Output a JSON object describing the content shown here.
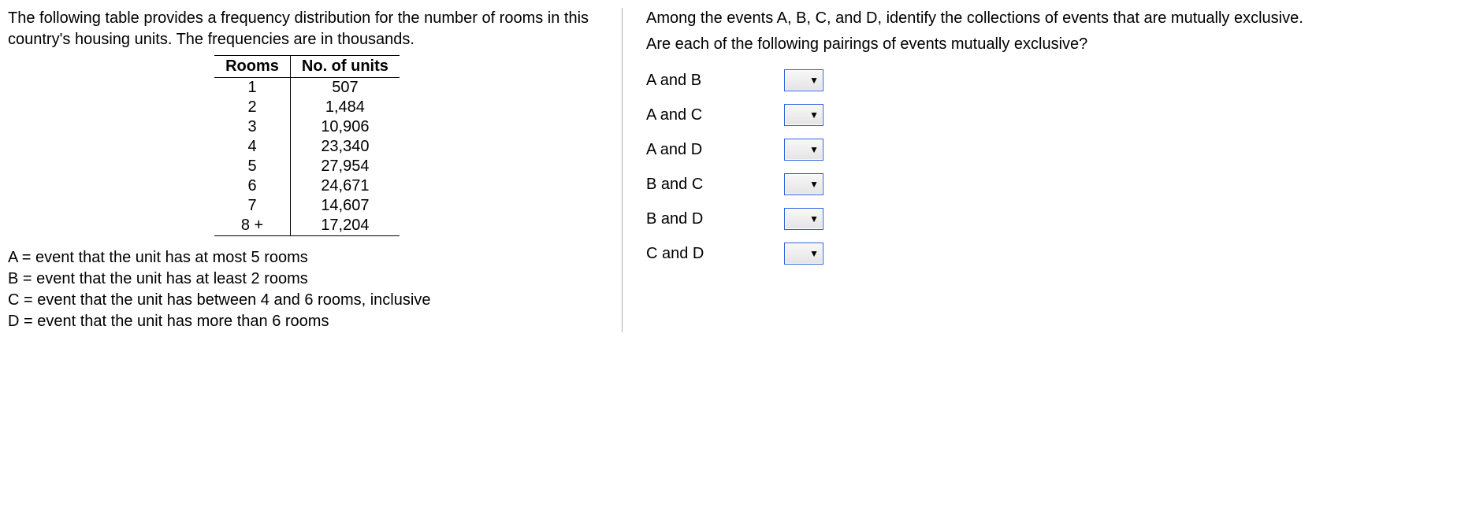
{
  "left": {
    "intro": "The following table provides a frequency distribution for the number of rooms in this country's housing units. The frequencies are in thousands.",
    "table": {
      "headers": {
        "col1": "Rooms",
        "col2": "No. of units"
      },
      "rows": [
        {
          "rooms": "1",
          "units": "507"
        },
        {
          "rooms": "2",
          "units": "1,484"
        },
        {
          "rooms": "3",
          "units": "10,906"
        },
        {
          "rooms": "4",
          "units": "23,340"
        },
        {
          "rooms": "5",
          "units": "27,954"
        },
        {
          "rooms": "6",
          "units": "24,671"
        },
        {
          "rooms": "7",
          "units": "14,607"
        },
        {
          "rooms": "8 +",
          "units": "17,204"
        }
      ]
    },
    "events": {
      "a": "A = event that the unit has at most 5 rooms",
      "b": "B = event that the unit has at least 2 rooms",
      "c": "C = event that the unit has between 4 and 6 rooms, inclusive",
      "d": "D = event that the unit has more than 6 rooms"
    }
  },
  "right": {
    "question": "Among the events A, B, C, and D, identify the collections of events that are mutually exclusive.",
    "sub_question": "Are each of the following pairings of events mutually exclusive?",
    "pairs": [
      {
        "label": "A and B"
      },
      {
        "label": "A and C"
      },
      {
        "label": "A and D"
      },
      {
        "label": "B and C"
      },
      {
        "label": "B and D"
      },
      {
        "label": "C and D"
      }
    ]
  },
  "icons": {
    "dropdown_arrow": "▼"
  }
}
